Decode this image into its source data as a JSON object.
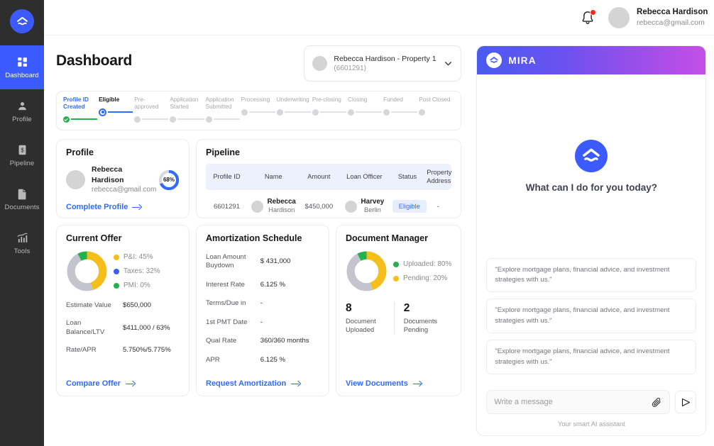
{
  "brand": {
    "logo_icon": "mira-logo-icon",
    "accent": "#3b5bfe"
  },
  "sidebar": {
    "items": [
      {
        "label": "Dashboard",
        "icon": "grid-icon",
        "active": true
      },
      {
        "label": "Profile",
        "icon": "user-icon",
        "active": false
      },
      {
        "label": "Pipeline",
        "icon": "document-dollar-icon",
        "active": false
      },
      {
        "label": "Documents",
        "icon": "file-icon",
        "active": false
      },
      {
        "label": "Tools",
        "icon": "chart-bars-icon",
        "active": false
      }
    ]
  },
  "topbar": {
    "notification_icon": "bell-icon",
    "has_notification": true,
    "user": {
      "name": "Rebecca Hardison",
      "email": "rebecca@gmail.com"
    }
  },
  "page": {
    "title": "Dashboard"
  },
  "property_select": {
    "title": "Rebecca Hardison - Property 1",
    "subtitle": "(6601291)",
    "chevron_icon": "chevron-down-icon"
  },
  "stepper": {
    "steps": [
      {
        "label": "Profile ID Created",
        "state": "done"
      },
      {
        "label": "Eligible",
        "state": "current"
      },
      {
        "label": "Pre-approved",
        "state": "todo"
      },
      {
        "label": "Application Started",
        "state": "todo"
      },
      {
        "label": "Application Submitted",
        "state": "todo"
      },
      {
        "label": "Processing",
        "state": "todo"
      },
      {
        "label": "Underwriting",
        "state": "todo"
      },
      {
        "label": "Pre-closing",
        "state": "todo"
      },
      {
        "label": "Closing",
        "state": "todo"
      },
      {
        "label": "Funded",
        "state": "todo"
      },
      {
        "label": "Post Closed",
        "state": "todo"
      }
    ]
  },
  "profile_card": {
    "title": "Profile",
    "name": "Rebecca Hardison",
    "email": "rebecca@gmail.com",
    "completion_pct": "68%",
    "completion_value": 68,
    "link_label": "Complete Profile"
  },
  "pipeline_card": {
    "title": "Pipeline",
    "columns": [
      "Profile ID",
      "Name",
      "Amount",
      "Loan Officer",
      "Status",
      "Property Address"
    ],
    "rows": [
      {
        "profile_id": "6601291",
        "name_first": "Rebecca",
        "name_last": "Hardison",
        "amount": "$450,000",
        "officer_first": "Harvey",
        "officer_last": "Berlin",
        "status": "Eligible",
        "property_address": "-"
      }
    ]
  },
  "current_offer": {
    "title": "Current Offer",
    "link_label": "Compare Offer",
    "rows": [
      {
        "key": "Estimate Value",
        "value": "$650,000"
      },
      {
        "key": "Loan Balance/LTV",
        "value": "$411,000 / 63%"
      },
      {
        "key": "Rate/APR",
        "value": "5.750%/5.775%"
      }
    ]
  },
  "amortization": {
    "title": "Amortization Schedule",
    "link_label": "Request Amortization",
    "rows": [
      {
        "key": "Loan Amount Buydown",
        "value": "$ 431,000"
      },
      {
        "key": "Interest Rate",
        "value": "6.125 %"
      },
      {
        "key": "Terms/Due in",
        "value": "-"
      },
      {
        "key": "1st PMT Date",
        "value": "-"
      },
      {
        "key": "Qual Rate",
        "value": "360/360 months"
      },
      {
        "key": "APR",
        "value": "6.125 %"
      }
    ]
  },
  "document_manager": {
    "title": "Document Manager",
    "link_label": "View Documents",
    "stats": [
      {
        "number": "8",
        "caption": "Document Uploaded"
      },
      {
        "number": "2",
        "caption": "Documents Pending"
      }
    ]
  },
  "chat": {
    "title": "MIRA",
    "logo_icon": "mira-logo-icon",
    "hero_text": "What can I do for you today?",
    "suggestions": [
      "\"Explore mortgage plans, financial advice, and investment strategies with us.\"",
      "\"Explore mortgage plans, financial advice, and investment strategies with us.\"",
      "\"Explore mortgage plans, financial advice, and investment strategies with us.\""
    ],
    "input_placeholder": "Write a message",
    "input_value": "",
    "attach_icon": "paperclip-icon",
    "send_icon": "send-icon",
    "footer": "Your smart AI assistant"
  },
  "chart_data": [
    {
      "type": "pie",
      "title": "Current Offer",
      "categories": [
        "P&I",
        "Taxes",
        "PMI"
      ],
      "values": [
        45,
        32,
        0
      ],
      "legend_labels": [
        "P&I: 45%",
        "Taxes: 32%",
        "PMI: 0%"
      ],
      "legend_colors": [
        "#f5be1a",
        "#3b5bfb",
        "#22b14c"
      ],
      "segment_colors": [
        "#f5be1a",
        "#c3c4cd",
        "#22b14c"
      ],
      "segment_values": [
        45,
        47,
        8
      ],
      "legend_position": "right"
    },
    {
      "type": "pie",
      "title": "Document Manager",
      "categories": [
        "Uploaded",
        "Pending"
      ],
      "values": [
        80,
        20
      ],
      "legend_labels": [
        "Uploaded: 80%",
        "Pending: 20%"
      ],
      "legend_colors": [
        "#22b14c",
        "#f5be1a"
      ],
      "segment_colors": [
        "#f5be1a",
        "#c3c4cd",
        "#22b14c"
      ],
      "segment_values": [
        45,
        47,
        8
      ],
      "legend_position": "right"
    }
  ]
}
